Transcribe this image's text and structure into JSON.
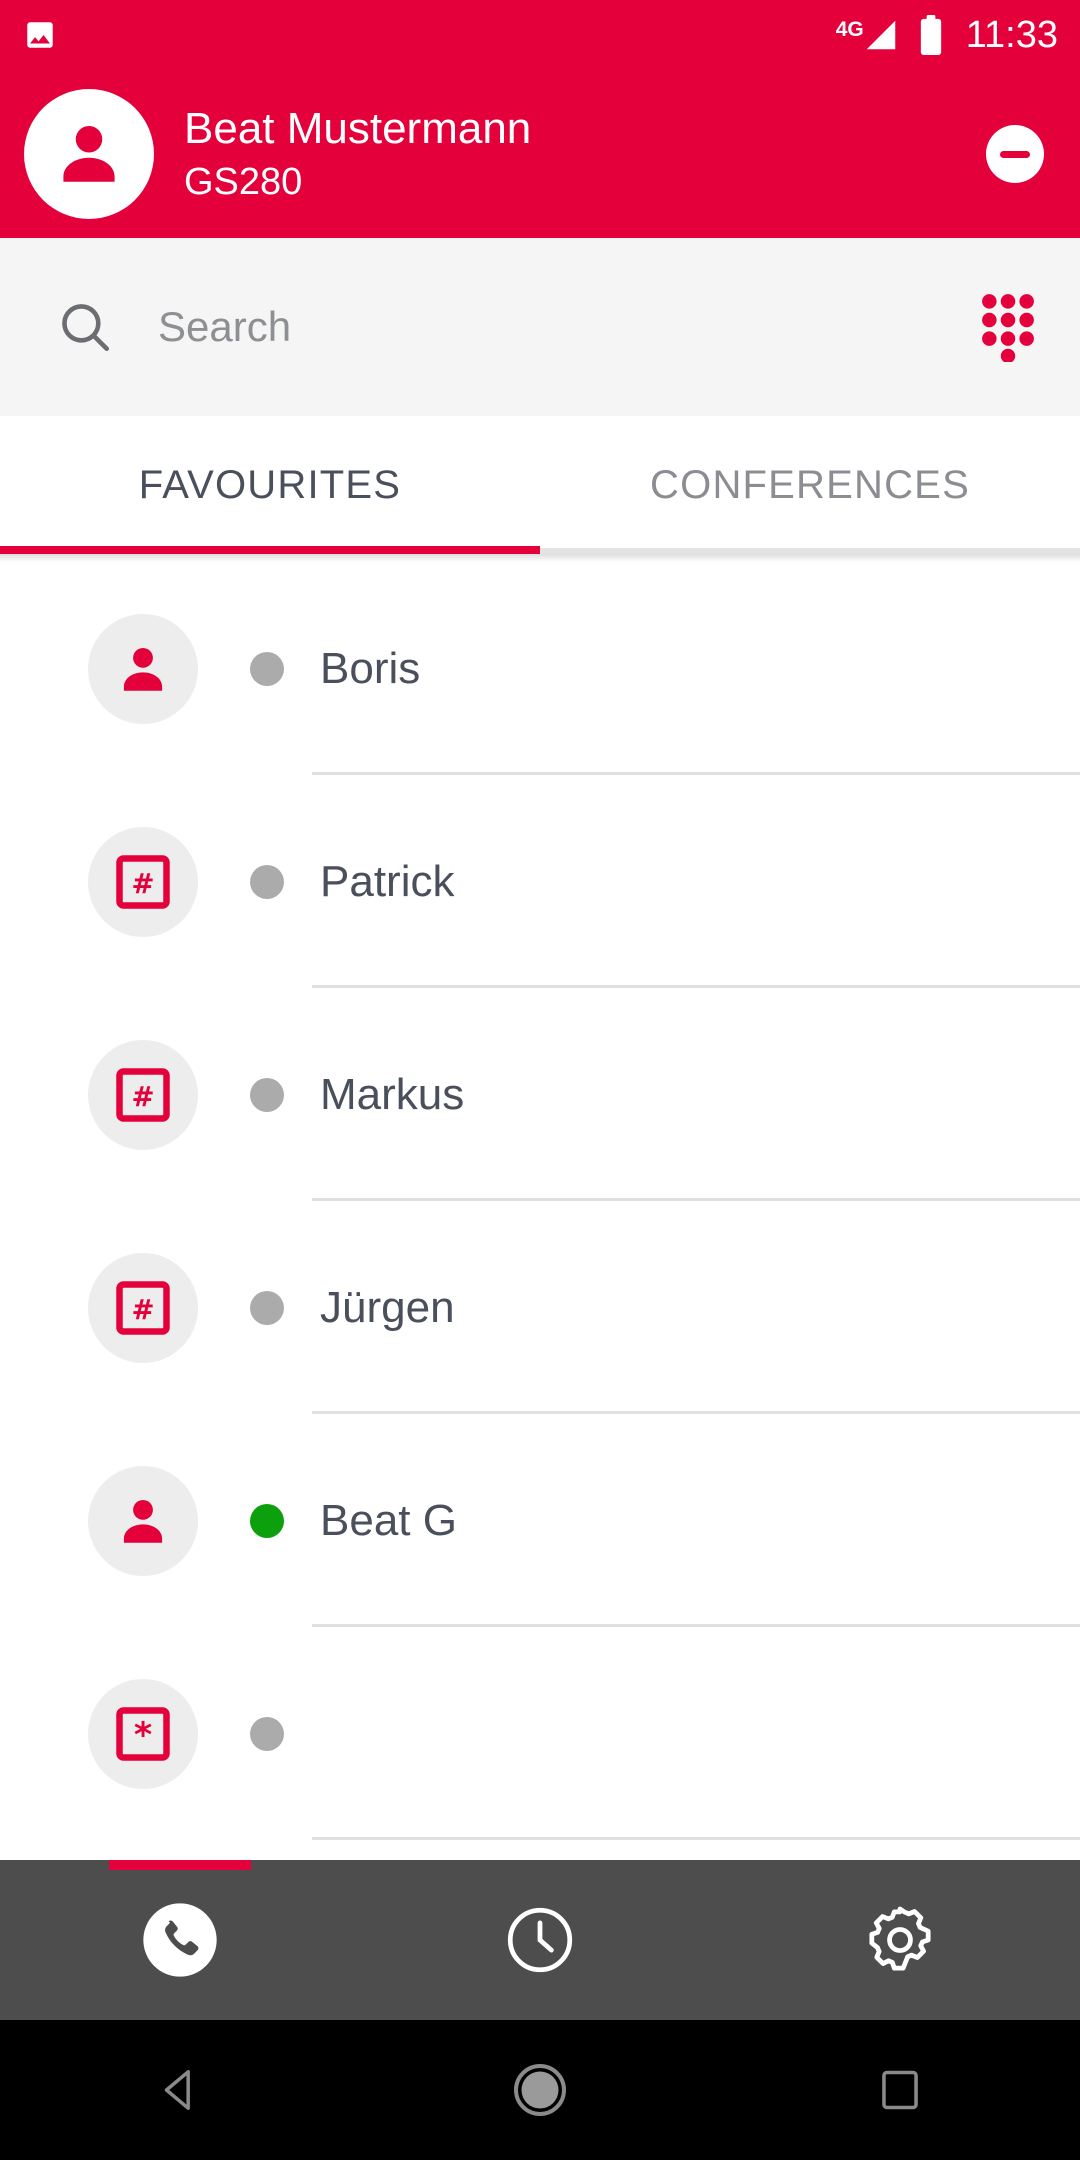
{
  "colors": {
    "brand": "#E4003A",
    "online": "#0CA00C",
    "offline": "#ABABAB",
    "tab_active_text": "#4A4F5C",
    "tab_inactive_text": "#8B8D92",
    "bottom_nav_bg": "#4D4D4D",
    "search_bg": "#F5F5F6",
    "avatar_bg": "#EDEDED"
  },
  "status_bar": {
    "notification_icon": "photo-icon",
    "network_label": "4G",
    "signal_icon": "signal-bars-icon",
    "battery_icon": "battery-full-icon",
    "time": "11:33"
  },
  "header": {
    "avatar_icon": "person-icon",
    "name": "Beat Mustermann",
    "device": "GS280",
    "action_icon": "minus-circle-icon",
    "action_name": "do-not-disturb-button"
  },
  "search": {
    "icon": "search-icon",
    "value": "",
    "placeholder": "Search",
    "keypad_icon": "dialpad-icon"
  },
  "tabs": [
    {
      "label": "FAVOURITES",
      "active": true
    },
    {
      "label": "CONFERENCES",
      "active": false
    }
  ],
  "contacts": [
    {
      "name": "Boris",
      "avatar_icon": "person-icon",
      "presence": "offline"
    },
    {
      "name": "Patrick",
      "avatar_icon": "hash-icon",
      "presence": "offline"
    },
    {
      "name": "Markus",
      "avatar_icon": "hash-icon",
      "presence": "offline"
    },
    {
      "name": "Jürgen",
      "avatar_icon": "hash-icon",
      "presence": "offline"
    },
    {
      "name": "Beat G",
      "avatar_icon": "person-icon",
      "presence": "online"
    },
    {
      "name": "",
      "avatar_icon": "asterisk-icon",
      "presence": "offline"
    }
  ],
  "bottom_nav": [
    {
      "icon": "phone-icon",
      "name": "nav-calls",
      "active": true
    },
    {
      "icon": "clock-icon",
      "name": "nav-history",
      "active": false
    },
    {
      "icon": "gear-icon",
      "name": "nav-settings",
      "active": false
    }
  ],
  "android_nav": [
    {
      "icon": "back-triangle-icon",
      "name": "android-back-button"
    },
    {
      "icon": "home-circle-icon",
      "name": "android-home-button"
    },
    {
      "icon": "recents-square-icon",
      "name": "android-recents-button"
    }
  ]
}
